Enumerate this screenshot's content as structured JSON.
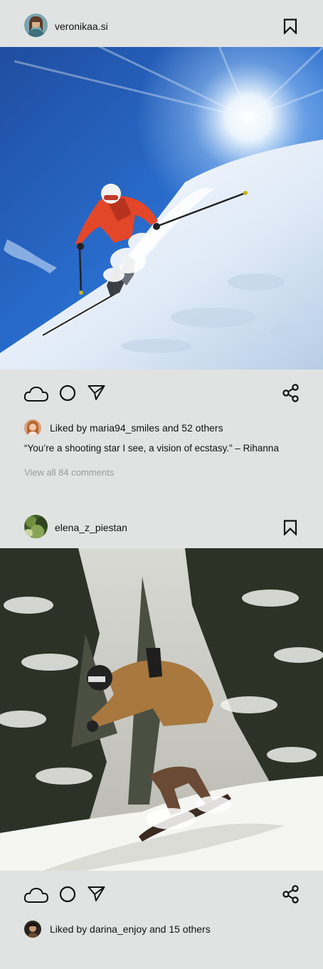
{
  "posts": [
    {
      "username": "veronikaa.si",
      "likes_text": "Liked by maria94_smiles and 52 others",
      "caption": "“You’re a shooting star I see, a vision of ecstasy.” – Rihanna",
      "comments_link": "View all 84 comments"
    },
    {
      "username": "elena_z_piestan",
      "likes_text": "Liked by darina_enjoy and 15 others"
    }
  ],
  "icons": [
    "bookmark-icon",
    "cloud-like-icon",
    "comment-circle-icon",
    "send-icon",
    "share-icon"
  ]
}
